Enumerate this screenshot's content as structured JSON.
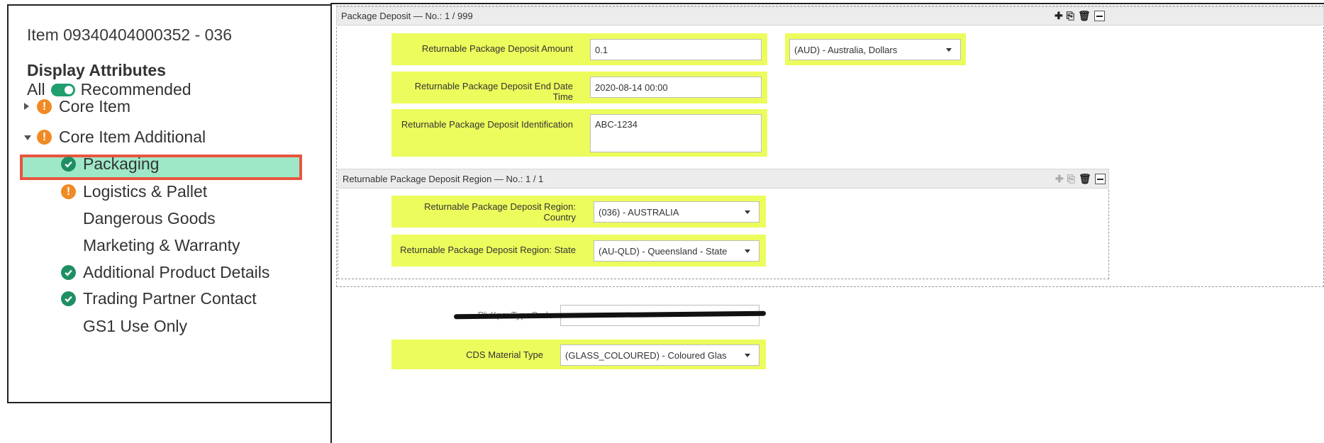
{
  "left": {
    "item_title": "Item 09340404000352 - 036",
    "display_attributes": "Display Attributes",
    "toggle_all": "All",
    "toggle_recommended": "Recommended",
    "tree": [
      {
        "label": "Core Item",
        "status": "warning",
        "caret": "right"
      },
      {
        "label": "Core Item Additional",
        "status": "warning",
        "caret": "down"
      },
      {
        "label": "Packaging",
        "status": "ok",
        "selected": true
      },
      {
        "label": "Logistics & Pallet",
        "status": "warning"
      },
      {
        "label": "Dangerous Goods",
        "status": "none"
      },
      {
        "label": "Marketing & Warranty",
        "status": "none"
      },
      {
        "label": "Additional Product Details",
        "status": "ok"
      },
      {
        "label": "Trading Partner Contact",
        "status": "ok"
      },
      {
        "label": "GS1 Use Only",
        "status": "none"
      }
    ]
  },
  "deposit": {
    "header": "Package Deposit — No.: 1 / 999",
    "amount_label": "Returnable Package Deposit Amount",
    "amount_value": "0.1",
    "currency_value": "(AUD) - Australia, Dollars",
    "end_date_label": "Returnable Package Deposit End Date Time",
    "end_date_value": "2020-08-14 00:00",
    "id_label": "Returnable Package Deposit Identification",
    "id_value": "ABC-1234"
  },
  "region": {
    "header": "Returnable Package Deposit Region — No.: 1 / 1",
    "country_label_1": "Returnable Package Deposit Region:",
    "country_label_2": "Country",
    "country_value": "(036) - AUSTRALIA",
    "state_label": "Returnable Package Deposit Region: State",
    "state_value": "(AU-QLD) - Queensland - State"
  },
  "lower": {
    "redacted_label": "PlvKpsvTypeCode",
    "material_label": "CDS Material Type",
    "material_value": "(GLASS_COLOURED) - Coloured Glas"
  },
  "colors": {
    "field_highlight": "#ecfc5c",
    "selected_row": "#9ee8c8",
    "selection_border": "#e8553f",
    "arrow": "#e8703f",
    "warning": "#f08a24",
    "ok": "#1e8f63"
  },
  "icons": [
    "warning-icon",
    "check-circle-icon",
    "plus-icon",
    "copy-icon",
    "trash-icon",
    "minus-icon",
    "dropdown-caret-icon"
  ]
}
